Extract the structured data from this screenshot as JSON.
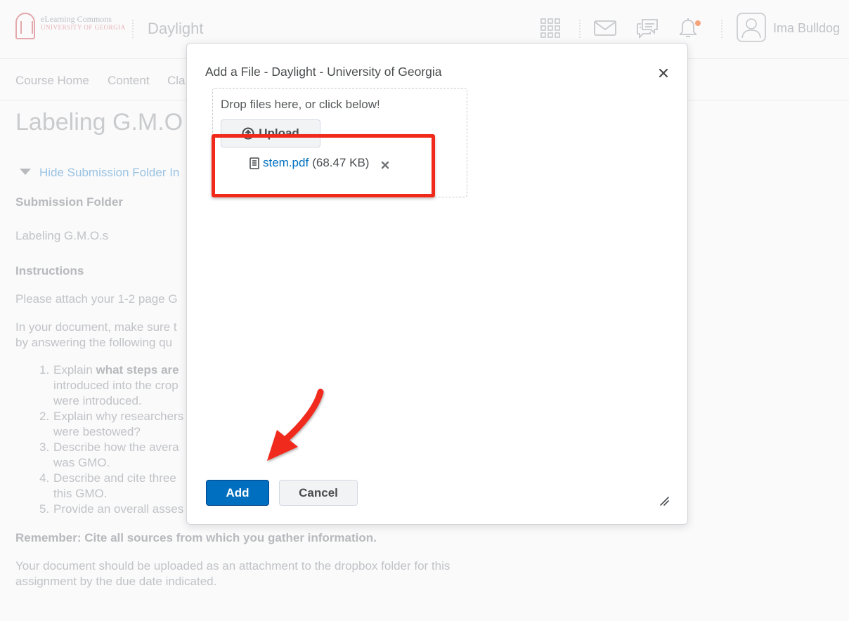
{
  "header": {
    "logo_line1": "eLearning Commons",
    "logo_line2": "UNIVERSITY OF GEORGIA",
    "course_title": "Daylight",
    "user_name": "Ima Bulldog",
    "icons": [
      "grid-icon",
      "mail-icon",
      "chat-icon",
      "bell-icon",
      "user-icon"
    ],
    "notification_color": "#f5a37a"
  },
  "nav": {
    "items": [
      "Course Home",
      "Content",
      "Cla"
    ]
  },
  "page": {
    "title": "Labeling G.M.O",
    "hide_link": "Hide Submission Folder In",
    "submission_folder_heading": "Submission Folder",
    "folder_name": "Labeling G.M.O.s",
    "instructions_heading": "Instructions",
    "instructions_p1": "Please attach your 1-2 page G",
    "instructions_p2_line1": "In your document, make sure t",
    "instructions_p2_line2": "by answering the following qu",
    "list": [
      {
        "num": "1.",
        "lines": [
          "Explain what steps are",
          "introduced into the crop",
          "were introduced."
        ],
        "bold_part": "what steps are"
      },
      {
        "num": "2.",
        "lines": [
          "Explain why researchers",
          "were bestowed?"
        ]
      },
      {
        "num": "3.",
        "lines": [
          "Describe how the avera",
          "was GMO."
        ]
      },
      {
        "num": "4.",
        "lines": [
          "Describe and cite three",
          "this GMO."
        ]
      },
      {
        "num": "5.",
        "lines": [
          "Provide an overall asses"
        ]
      }
    ],
    "remember": "Remember: Cite all sources from which you gather information.",
    "closing_line1": "Your document should be uploaded as an attachment to the dropbox folder for this",
    "closing_line2": "assignment by the due date indicated."
  },
  "dialog": {
    "title": "Add a File - Daylight - University of Georgia",
    "close_label": "×",
    "drop_text": "Drop files here, or click below!",
    "upload_label": "Upload",
    "file": {
      "name": "stem.pdf",
      "size": "(68.47 KB)"
    },
    "add_label": "Add",
    "cancel_label": "Cancel"
  },
  "colors": {
    "primary": "#006fbf",
    "annotation_red": "#f0291a"
  }
}
